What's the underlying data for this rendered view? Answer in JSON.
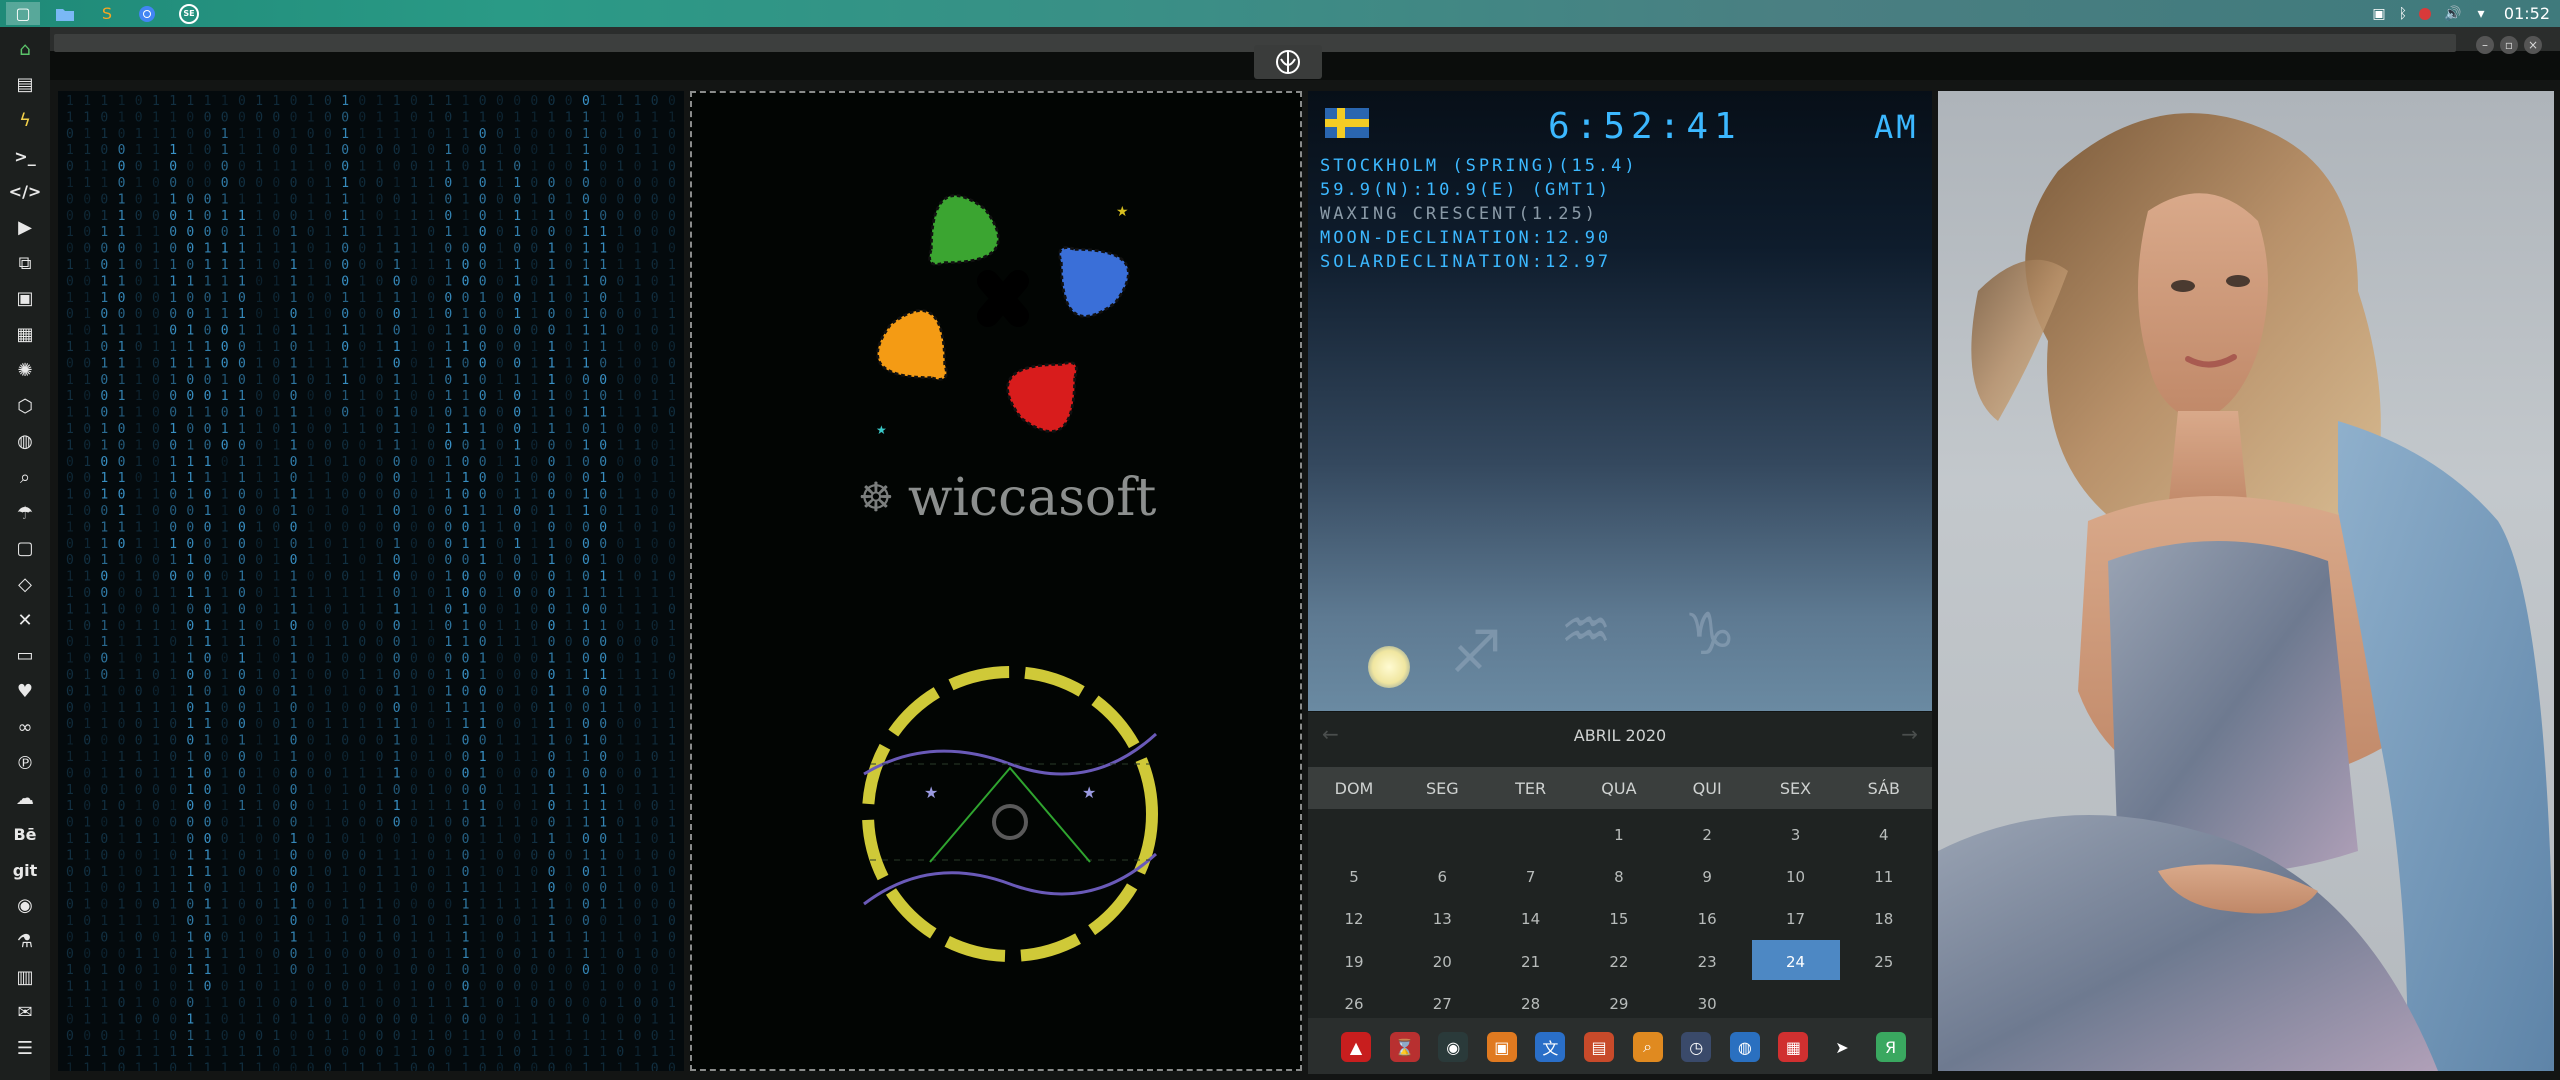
{
  "top_panel": {
    "launchers": [
      {
        "icon": "workspace-icon"
      },
      {
        "icon": "files-icon"
      },
      {
        "icon": "sublime-icon"
      },
      {
        "icon": "chrome-icon"
      },
      {
        "icon": "se-icon",
        "label": "SE"
      }
    ],
    "tray": [
      "photo-icon",
      "bluetooth-icon",
      "record-icon",
      "volume-icon",
      "wifi-icon"
    ],
    "clock": "01:52"
  },
  "left_dock": {
    "items": [
      {
        "name": "home-icon",
        "glyph": "⌂"
      },
      {
        "name": "file-icon",
        "glyph": "▤"
      },
      {
        "name": "bolt-icon",
        "glyph": "ϟ"
      },
      {
        "name": "terminal-icon",
        "glyph": ">_"
      },
      {
        "name": "code-icon",
        "glyph": "</>"
      },
      {
        "name": "play-icon",
        "glyph": "▶"
      },
      {
        "name": "copy-icon",
        "glyph": "⧉"
      },
      {
        "name": "image-icon",
        "glyph": "▣"
      },
      {
        "name": "news-icon",
        "glyph": "▦"
      },
      {
        "name": "settings-icon",
        "glyph": "✺"
      },
      {
        "name": "hexagon-icon",
        "glyph": "⬡"
      },
      {
        "name": "globe-icon",
        "glyph": "◍"
      },
      {
        "name": "search-icon",
        "glyph": "⌕"
      },
      {
        "name": "umbrella-icon",
        "glyph": "☂"
      },
      {
        "name": "contact-icon",
        "glyph": "▢"
      },
      {
        "name": "diamond-code-icon",
        "glyph": "◇"
      },
      {
        "name": "tools-icon",
        "glyph": "✕"
      },
      {
        "name": "youtube-icon",
        "glyph": "▭"
      },
      {
        "name": "heart-icon",
        "glyph": "♥"
      },
      {
        "name": "infinity-icon",
        "glyph": "∞"
      },
      {
        "name": "pinterest-icon",
        "glyph": "℗"
      },
      {
        "name": "cloud-icon",
        "glyph": "☁"
      },
      {
        "name": "behance-icon",
        "glyph": "Bē"
      },
      {
        "name": "git-icon",
        "glyph": "git"
      },
      {
        "name": "github-icon",
        "glyph": "◉"
      },
      {
        "name": "molecule-icon",
        "glyph": "⚗"
      },
      {
        "name": "map-icon",
        "glyph": "▥"
      },
      {
        "name": "mail-icon",
        "glyph": "✉"
      },
      {
        "name": "list-icon",
        "glyph": "☰"
      }
    ]
  },
  "window": {
    "controls": [
      "minimize-icon",
      "maximize-icon",
      "close-icon"
    ],
    "tab_icon": "rebel-alliance-icon"
  },
  "matrix": {
    "color": "#3a93c8"
  },
  "logo_panel": {
    "brand": "wiccasoft",
    "petal_colors": [
      "#3ba531",
      "#3a6fd8",
      "#f49b14",
      "#d81c1c"
    ]
  },
  "clock_widget": {
    "time": "6:52:41",
    "ampm": "AM",
    "flag": "sweden-flag",
    "lines": [
      "STOCKHOLM (SPRING)(15.4)",
      "59.9(N):10.9(E) (GMT1)",
      "WAXING CRESCENT(1.25)",
      "MOON-DECLINATION:12.90",
      "SOLARDECLINATION:12.97"
    ]
  },
  "calendar": {
    "title": "ABRIL 2020",
    "weekdays": [
      "DOM",
      "SEG",
      "TER",
      "QUA",
      "QUI",
      "SEX",
      "SÁB"
    ],
    "weeks": [
      [
        "",
        "",
        "",
        "1",
        "2",
        "3",
        "4"
      ],
      [
        "5",
        "6",
        "7",
        "8",
        "9",
        "10",
        "11"
      ],
      [
        "12",
        "13",
        "14",
        "15",
        "16",
        "17",
        "18"
      ],
      [
        "19",
        "20",
        "21",
        "22",
        "23",
        "24",
        "25"
      ],
      [
        "26",
        "27",
        "28",
        "29",
        "30",
        "",
        ""
      ]
    ],
    "selected": "24",
    "selected_color": "#4d88c4"
  },
  "app_dock": {
    "apps": [
      {
        "name": "acrobat-icon",
        "color": "#c81e1e",
        "glyph": "▲"
      },
      {
        "name": "hourglass-icon",
        "color": "#b83030",
        "glyph": "⌛"
      },
      {
        "name": "sphere-icon",
        "color": "#2a3a3a",
        "glyph": "◉"
      },
      {
        "name": "image-viewer-icon",
        "color": "#e07a20",
        "glyph": "▣"
      },
      {
        "name": "translate-icon",
        "color": "#2a6fc8",
        "glyph": "文"
      },
      {
        "name": "reader-icon",
        "color": "#c84a2a",
        "glyph": "▤"
      },
      {
        "name": "magnifier-icon",
        "color": "#e08a20",
        "glyph": "⌕"
      },
      {
        "name": "clock-app-icon",
        "color": "#3a4a6a",
        "glyph": "◷"
      },
      {
        "name": "web-icon",
        "color": "#2a70c0",
        "glyph": "◍"
      },
      {
        "name": "calendar-app-icon",
        "color": "#d03030",
        "glyph": "▦"
      },
      {
        "name": "arrow-app-icon",
        "color": "#2a2e2d",
        "glyph": "➤"
      },
      {
        "name": "yandex-icon",
        "color": "#3aa860",
        "glyph": "Я"
      }
    ]
  }
}
